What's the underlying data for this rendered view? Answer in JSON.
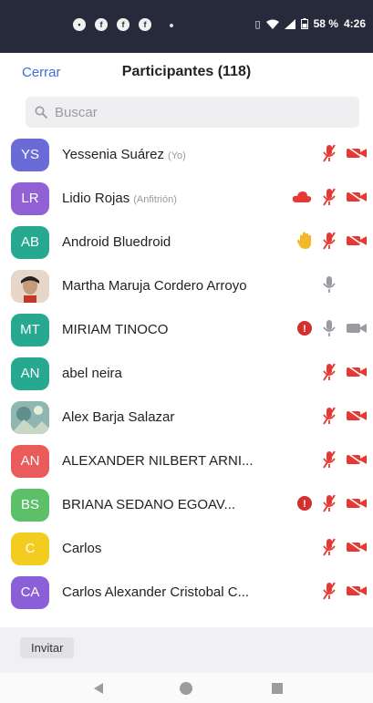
{
  "status_bar": {
    "battery": "58 %",
    "time": "4:26"
  },
  "header": {
    "close_label": "Cerrar",
    "title": "Participantes (118)"
  },
  "search": {
    "placeholder": "Buscar"
  },
  "participants": [
    {
      "initials": "YS",
      "name": "Yessenia Suárez",
      "role": "(Yo)",
      "color": "#6b6bd8",
      "photo": false,
      "hand": false,
      "cloud": false,
      "chat_badge": false,
      "mic": "muted",
      "video": "off"
    },
    {
      "initials": "LR",
      "name": "Lidio Rojas",
      "role": "(Anfitrión)",
      "color": "#9160d4",
      "photo": false,
      "hand": false,
      "cloud": true,
      "chat_badge": false,
      "mic": "muted",
      "video": "off"
    },
    {
      "initials": "AB",
      "name": "Android Bluedroid",
      "role": "",
      "color": "#27a891",
      "photo": false,
      "hand": true,
      "cloud": false,
      "chat_badge": false,
      "mic": "muted",
      "video": "off"
    },
    {
      "initials": "",
      "name": "Martha Maruja Cordero Arroyo",
      "role": "",
      "color": "#e6d7c9",
      "photo": true,
      "hand": false,
      "cloud": false,
      "chat_badge": false,
      "mic": "on",
      "video": "none"
    },
    {
      "initials": "MT",
      "name": "MIRIAM TINOCO",
      "role": "",
      "color": "#27a891",
      "photo": false,
      "hand": false,
      "cloud": false,
      "chat_badge": true,
      "mic": "on",
      "video": "on"
    },
    {
      "initials": "AN",
      "name": "abel neira",
      "role": "",
      "color": "#27a891",
      "photo": false,
      "hand": false,
      "cloud": false,
      "chat_badge": false,
      "mic": "muted",
      "video": "off"
    },
    {
      "initials": "",
      "name": "Alex Barja Salazar",
      "role": "",
      "color": "#7aa7a0",
      "photo": true,
      "hand": false,
      "cloud": false,
      "chat_badge": false,
      "mic": "muted",
      "video": "off"
    },
    {
      "initials": "AN",
      "name": "ALEXANDER NILBERT ARNI...",
      "role": "",
      "color": "#ea5b5b",
      "photo": false,
      "hand": false,
      "cloud": false,
      "chat_badge": false,
      "mic": "muted",
      "video": "off"
    },
    {
      "initials": "BS",
      "name": "BRIANA SEDANO EGOAV...",
      "role": "",
      "color": "#5cc068",
      "photo": false,
      "hand": false,
      "cloud": false,
      "chat_badge": true,
      "mic": "muted",
      "video": "off"
    },
    {
      "initials": "C",
      "name": "Carlos",
      "role": "",
      "color": "#f2cc1f",
      "photo": false,
      "hand": false,
      "cloud": false,
      "chat_badge": false,
      "mic": "muted",
      "video": "off"
    },
    {
      "initials": "CA",
      "name": "Carlos Alexander Cristobal C...",
      "role": "",
      "color": "#8a5fd8",
      "photo": false,
      "hand": false,
      "cloud": false,
      "chat_badge": false,
      "mic": "muted",
      "video": "off"
    }
  ],
  "footer": {
    "invite_label": "Invitar"
  }
}
